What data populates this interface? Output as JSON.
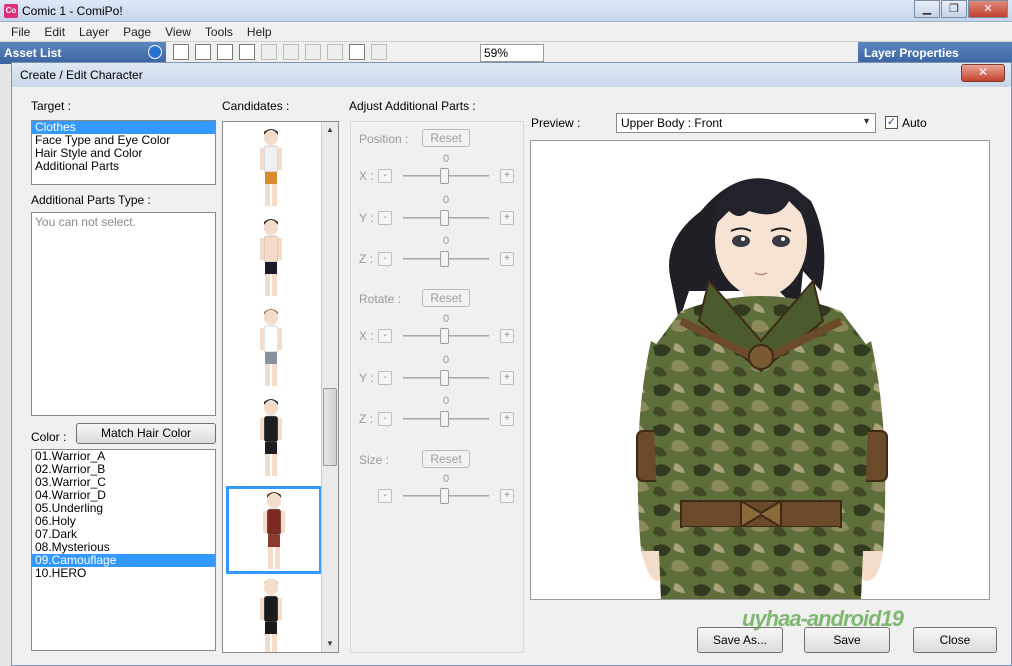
{
  "app": {
    "title": "Comic 1 - ComiPo!",
    "icon_label": "Co",
    "window_buttons": [
      "▁",
      "❐",
      "✕"
    ],
    "menu": [
      "File",
      "Edit",
      "Layer",
      "Page",
      "View",
      "Tools",
      "Help"
    ],
    "asset_list_title": "Asset List",
    "layer_properties_title": "Layer Properties",
    "zoom": "59%"
  },
  "dialog": {
    "title": "Create / Edit Character",
    "close_label": "✕",
    "target_label": "Target :",
    "target_items": [
      "Clothes",
      "Face Type and Eye Color",
      "Hair Style and Color",
      "Additional Parts"
    ],
    "target_selected_index": 0,
    "additional_parts_type_label": "Additional Parts Type :",
    "additional_parts_placeholder": "You can not select.",
    "color_label": "Color :",
    "match_hair_color_label": "Match Hair Color",
    "color_items": [
      "01.Warrior_A",
      "02.Warrior_B",
      "03.Warrior_C",
      "04.Warrior_D",
      "05.Underling",
      "06.Holy",
      "07.Dark",
      "08.Mysterious",
      "09.Camouflage",
      "10.HERO"
    ],
    "color_selected_index": 8,
    "candidates_label": "Candidates :",
    "candidates": [
      {
        "name": "orange-shorts",
        "top": "#f0f0f0",
        "bottom": "#d98a30",
        "hair": "#3a2218"
      },
      {
        "name": "swimwear",
        "top": "#f6dcc8",
        "bottom": "#1a1a2a",
        "hair": "#3a2218"
      },
      {
        "name": "white-shirt",
        "top": "#ffffff",
        "bottom": "#8a90a0",
        "hair": "#b07a40"
      },
      {
        "name": "black-suit",
        "top": "#1e1e22",
        "bottom": "#1e1e22",
        "hair": "#2a2a2a"
      },
      {
        "name": "red-armor",
        "top": "#7a2a22",
        "bottom": "#8a3a2a",
        "hair": "#5a3020"
      },
      {
        "name": "bald-suit",
        "top": "#1a1a1a",
        "bottom": "#1a1a1a",
        "hair": "#e8c8a8"
      }
    ],
    "candidate_selected_index": 4,
    "adjust_label": "Adjust Additional Parts :",
    "position_label": "Position :",
    "rotate_label": "Rotate :",
    "size_label": "Size :",
    "reset_label": "Reset",
    "axis_x": "X :",
    "axis_y": "Y :",
    "axis_z": "Z :",
    "slider_value": "0",
    "minus": "-",
    "plus": "+",
    "preview_label": "Preview :",
    "preview_option": "Upper Body : Front",
    "auto_label": "Auto",
    "auto_checked": "✓",
    "save_as_label": "Save As...",
    "save_label": "Save",
    "close_button_label": "Close"
  },
  "watermark": "uyhaa-android19"
}
